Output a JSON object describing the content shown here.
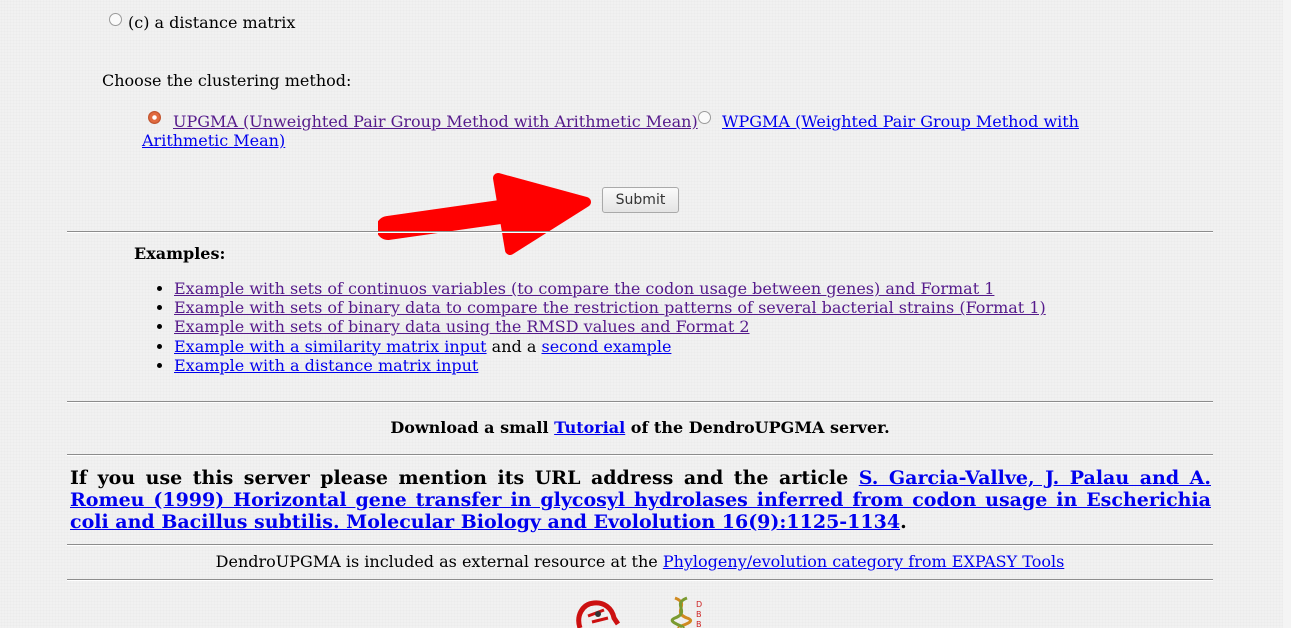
{
  "matrix_option": {
    "label": "(c) a distance matrix"
  },
  "clustering": {
    "prompt": "Choose the clustering method:",
    "upgma_label": "UPGMA (Unweighted Pair Group Method with Arithmetic Mean)",
    "wpgma_label_line1": "WPGMA (Weighted Pair Group Method with",
    "wpgma_label_line2": "Arithmetic Mean)",
    "selected": "UPGMA"
  },
  "submit_label": "Submit",
  "examples": {
    "heading": "Examples:",
    "item1": "Example with sets of continuos variables (to compare the codon usage between genes) and Format 1",
    "item2": "Example with sets of binary data to compare the restriction patterns of several bacterial strains (Format 1)",
    "item3": "Example with sets of binary data using the RMSD values and Format 2",
    "item4_link": "Example with a similarity matrix input",
    "item4_mid": " and a ",
    "item4_link2": "second example",
    "item5": "Example with a distance matrix input"
  },
  "tutorial": {
    "prefix": "Download a small ",
    "link": "Tutorial",
    "suffix": " of the DendroUPGMA server."
  },
  "citation": {
    "prefix": "If you use this server please mention its URL address and the article ",
    "link": "S. Garcia-Vallve, J. Palau and A. Romeu (1999) Horizontal gene transfer in glycosyl hydrolases inferred from codon usage in Escherichia coli and Bacillus subtilis. Molecular Biology and Evololution 16(9):1125-1134",
    "suffix": "."
  },
  "expasy": {
    "prefix": "DendroUPGMA is included as external resource at the ",
    "link": "Phylogeny/evolution category from EXPASY Tools"
  },
  "colors": {
    "annotation_arrow": "#ff0000",
    "link_visited": "#551a8b",
    "link_unvisited": "#0000ee"
  }
}
